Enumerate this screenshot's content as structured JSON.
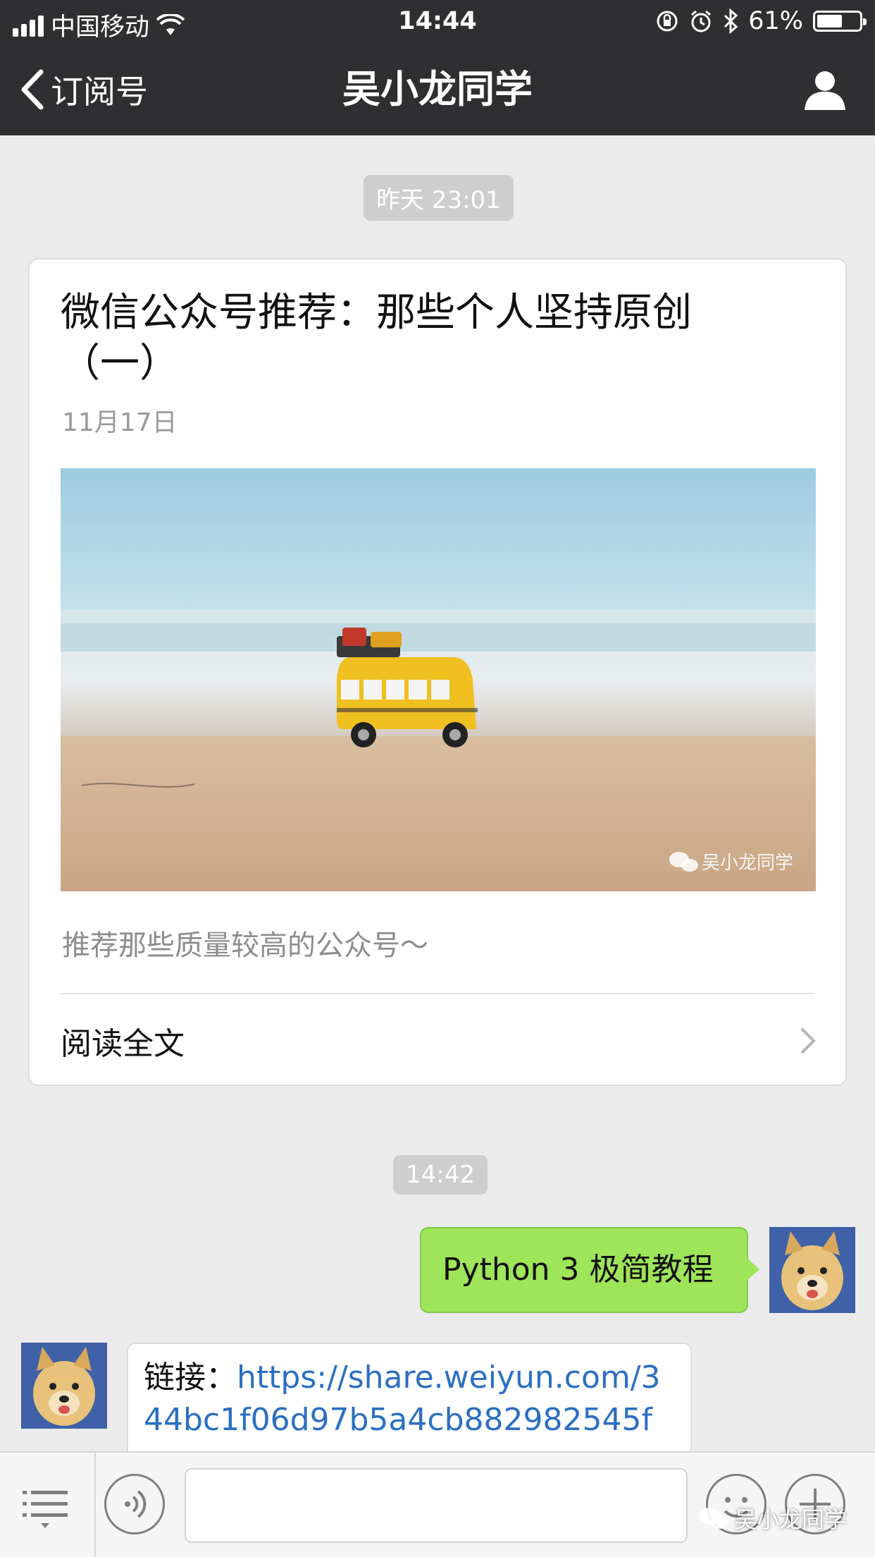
{
  "status_bar": {
    "carrier": "中国移动",
    "time": "14:44",
    "battery_percent": "61%",
    "battery_level": 0.61
  },
  "nav": {
    "back_label": "订阅号",
    "title": "吴小龙同学",
    "profile_icon": "person-icon"
  },
  "chat": {
    "timestamp_1": "昨天 23:01",
    "article": {
      "title": "微信公众号推荐：那些个人坚持原创（一）",
      "date": "11月17日",
      "image_watermark": "吴小龙同学",
      "description": "推荐那些质量较高的公众号～",
      "read_more": "阅读全文"
    },
    "timestamp_2": "14:42",
    "sent_message": "Python 3 极简教程",
    "received_message": {
      "prefix": "链接：",
      "link": "https://share.weiyun.com/344bc1f06d97b5a4cb882982545f"
    }
  },
  "input_bar": {
    "menu_icon": "menu-list-icon",
    "voice_icon": "voice-icon",
    "emoji_icon": "emoji-icon",
    "plus_icon": "plus-icon",
    "text_value": ""
  },
  "watermark": "吴小龙同学",
  "colors": {
    "header_bg": "#2f2f32",
    "chat_bg": "#ebebeb",
    "sent_bubble": "#9ee559",
    "link": "#2b6fc2"
  }
}
